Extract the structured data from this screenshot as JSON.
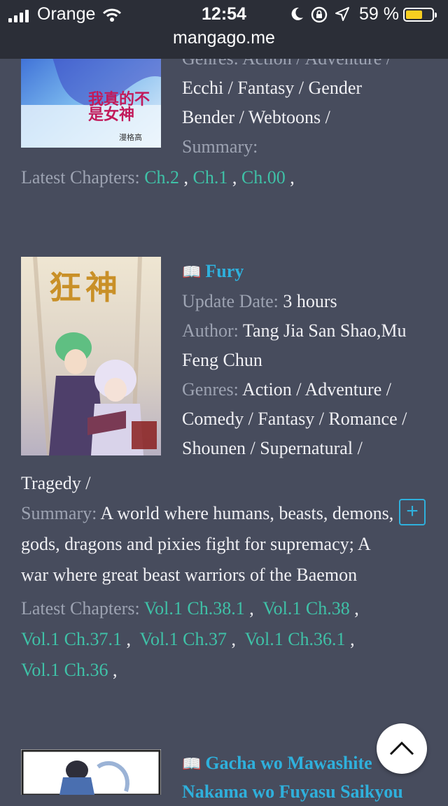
{
  "status_bar": {
    "carrier": "Orange",
    "time": "12:54",
    "battery_percent": "59 %",
    "battery_level": 0.59,
    "url": "mangago.me"
  },
  "entries": [
    {
      "cover_text": "我真的不是女神",
      "cover_subtext": "漫格高",
      "genres_label": "Genres:",
      "genres_line1": "Action / Adventure /",
      "genres_line2": "Ecchi / Fantasy / Gender",
      "genres_line3": "Bender / Webtoons /",
      "summary_label": "Summary:",
      "latest_label": "Latest Chapters:",
      "chapters": [
        "Ch.2",
        "Ch.1",
        "Ch.00"
      ]
    },
    {
      "title": "Fury",
      "cover_text": "狂神",
      "update_label": "Update Date:",
      "update_value": "3 hours",
      "author_label": "Author:",
      "author_line1": "Tang Jia San Shao,Mu",
      "author_line2": "Feng Chun",
      "genres_label": "Genres:",
      "genres_line1": "Action / Adventure /",
      "genres_line2": "Comedy / Fantasy / Romance /",
      "genres_line3": "Shounen / Supernatural /",
      "genres_line4": "Tragedy /",
      "summary_label": "Summary:",
      "summary_line1": "A world where humans, beasts, demons,",
      "summary_line2": "gods, dragons and pixies fight for supremacy; A",
      "summary_line3": "war where great beast warriors of the Baemon",
      "latest_label": "Latest Chapters:",
      "chapters": [
        "Vol.1 Ch.38.1",
        "Vol.1 Ch.38",
        "Vol.1 Ch.37.1",
        "Vol.1 Ch.37",
        "Vol.1 Ch.36.1",
        "Vol.1 Ch.36"
      ]
    },
    {
      "title_line1": "Gacha wo Mawashite",
      "title_line2": "Nakama wo Fuyasu Saikyou"
    }
  ],
  "buttons": {
    "plus": "+"
  }
}
